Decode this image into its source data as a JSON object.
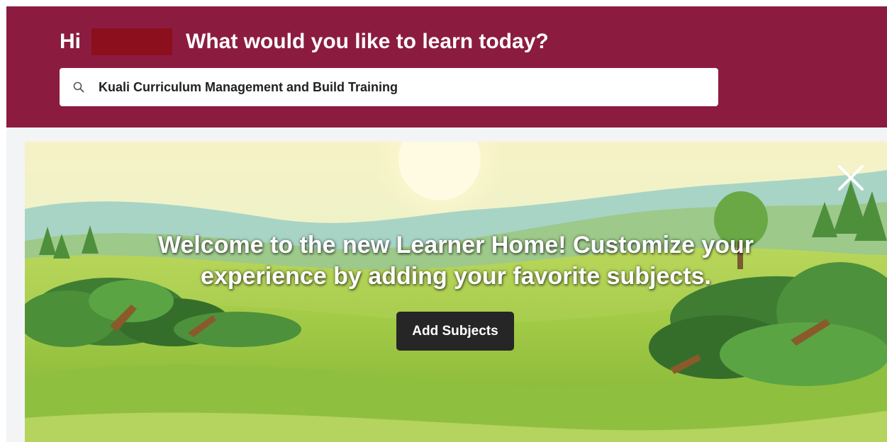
{
  "header": {
    "greeting_hi": "Hi",
    "greeting_question": "What would you like to learn today?",
    "background_color": "#8b1c40",
    "name_redaction_color": "#8c0f1d"
  },
  "search": {
    "value": "Kuali Curriculum Management and Build Training",
    "icon": "search-icon"
  },
  "banner": {
    "message": "Welcome to the new Learner Home! Customize your experience by adding your favorite subjects.",
    "add_subjects_label": "Add Subjects",
    "close_icon": "close-icon",
    "button_color": "#262626"
  }
}
